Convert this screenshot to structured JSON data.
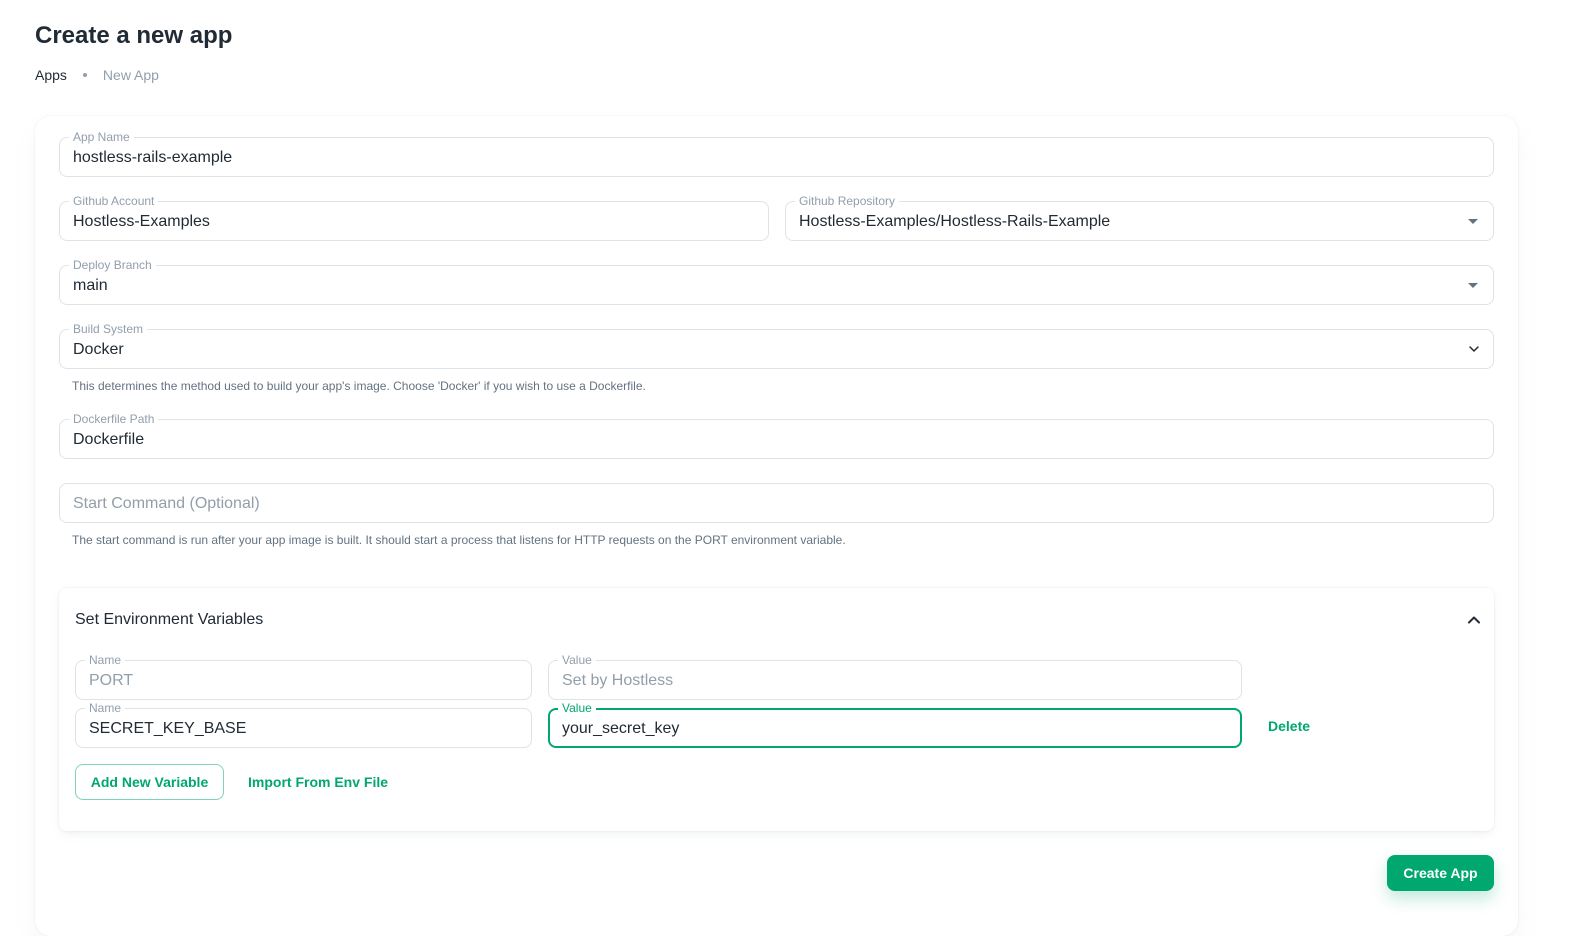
{
  "page": {
    "title": "Create a new app",
    "breadcrumb": {
      "current": "Apps",
      "next": "New App"
    }
  },
  "form": {
    "app_name": {
      "label": "App Name",
      "value": "hostless-rails-example"
    },
    "github_account": {
      "label": "Github Account",
      "value": "Hostless-Examples"
    },
    "github_repository": {
      "label": "Github Repository",
      "value": "Hostless-Examples/Hostless-Rails-Example"
    },
    "deploy_branch": {
      "label": "Deploy Branch",
      "value": "main"
    },
    "build_system": {
      "label": "Build System",
      "value": "Docker",
      "helper": "This determines the method used to build your app's image. Choose 'Docker' if you wish to use a Dockerfile."
    },
    "dockerfile_path": {
      "label": "Dockerfile Path",
      "value": "Dockerfile"
    },
    "start_command": {
      "placeholder": "Start Command (Optional)",
      "helper": "The start command is run after your app image is built. It should start a process that listens for HTTP requests on the PORT environment variable."
    }
  },
  "env": {
    "title": "Set Environment Variables",
    "rows": [
      {
        "name_label": "Name",
        "name": "PORT",
        "value_label": "Value",
        "value": "Set by Hostless"
      },
      {
        "name_label": "Name",
        "name": "SECRET_KEY_BASE",
        "value_label": "Value",
        "value": "your_secret_key",
        "delete_label": "Delete"
      }
    ],
    "add_label": "Add New Variable",
    "import_label": "Import From Env File"
  },
  "actions": {
    "create_label": "Create App"
  },
  "colors": {
    "accent": "#00a76f",
    "text": "#212b36",
    "muted": "#919eab",
    "border": "#dfe3e8"
  },
  "icons": {
    "repository_dropdown": "caret-down-icon",
    "branch_dropdown": "caret-down-icon",
    "build_system_select": "chevron-down-icon",
    "env_toggle": "chevron-up-icon"
  }
}
